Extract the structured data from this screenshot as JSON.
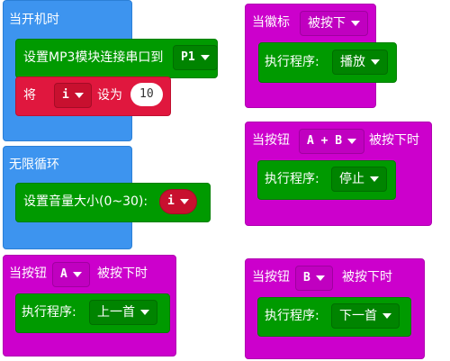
{
  "on_start": {
    "label": "当开机时",
    "mp3": {
      "label": "设置MP3模块连接串口到",
      "port": "P1"
    },
    "set_var": {
      "label": "将",
      "var": "i",
      "to": "设为",
      "value": "10"
    }
  },
  "forever": {
    "label": "无限循环",
    "volume": {
      "label": "设置音量大小(0~30):",
      "var": "i"
    }
  },
  "logo": {
    "label": "当徽标",
    "event": "被按下",
    "action_label": "执行程序:",
    "action": "播放"
  },
  "btn_ab": {
    "label": "当按钮",
    "button": "A + B",
    "suffix": "被按下时",
    "action_label": "执行程序:",
    "action": "停止"
  },
  "btn_a": {
    "label": "当按钮",
    "button": "A",
    "suffix": "被按下时",
    "action_label": "执行程序:",
    "action": "上一首"
  },
  "btn_b": {
    "label": "当按钮",
    "button": "B",
    "suffix": "被按下时",
    "action_label": "执行程序:",
    "action": "下一首"
  }
}
